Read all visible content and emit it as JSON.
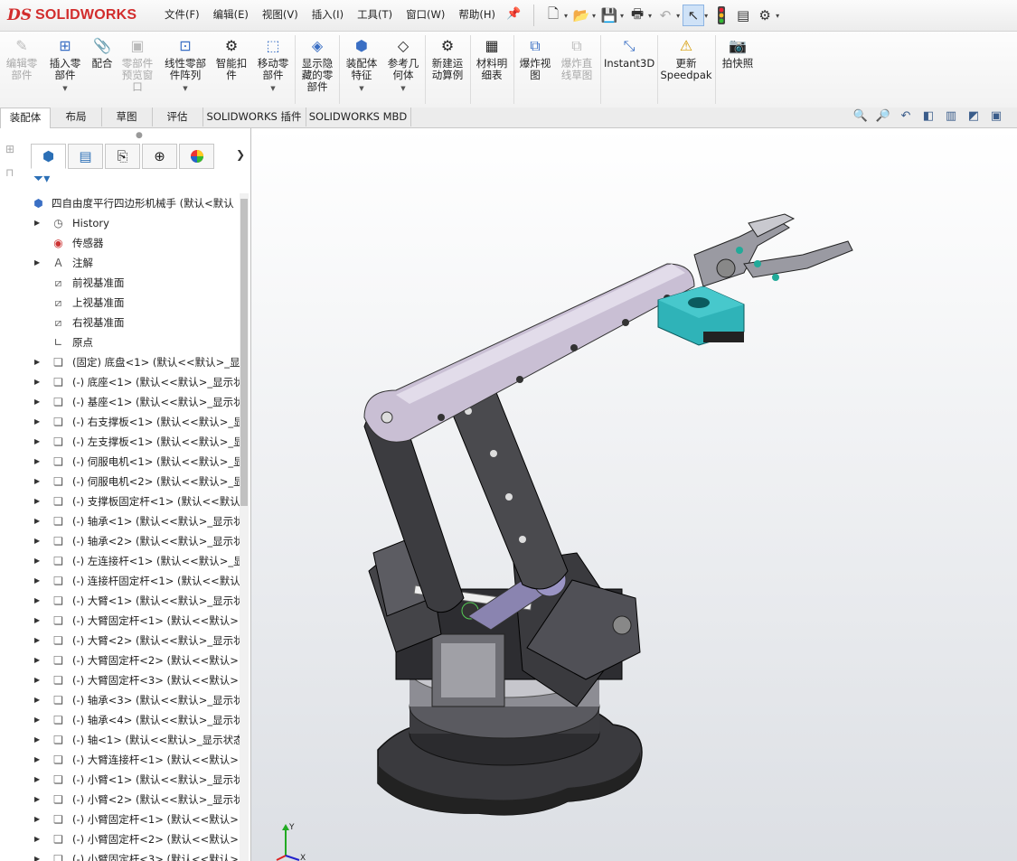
{
  "app": {
    "logo_ds": "DS",
    "logo_text": "SOLIDWORKS"
  },
  "menu": [
    "文件(F)",
    "编辑(E)",
    "视图(V)",
    "插入(I)",
    "工具(T)",
    "窗口(W)",
    "帮助(H)"
  ],
  "ribbon": {
    "edit_component": "编辑零\n部件",
    "insert_component": "插入零\n部件",
    "mate": "配合",
    "component_preview": "零部件\n预览窗\n口",
    "linear_pattern": "线性零部\n件阵列",
    "smart_fasteners": "智能扣\n件",
    "move_component": "移动零\n部件",
    "show_hidden": "显示隐\n藏的零\n部件",
    "assembly_features": "装配体\n特征",
    "reference_geometry": "参考几\n何体",
    "new_motion_study": "新建运\n动算例",
    "bom": "材料明\n细表",
    "exploded_view": "爆炸视\n图",
    "explode_line_sketch": "爆炸直\n线草图",
    "instant3d": "Instant3D",
    "update_speedpak": "更新\nSpeedpak",
    "snapshot": "拍快照"
  },
  "tabs": [
    "装配体",
    "布局",
    "草图",
    "评估",
    "SOLIDWORKS 插件",
    "SOLIDWORKS MBD"
  ],
  "tree": {
    "root": "四自由度平行四边形机械手  (默认<默认",
    "fixed_items": [
      {
        "label": "History",
        "icon": "history-icon"
      },
      {
        "label": "传感器",
        "icon": "sensor-icon"
      },
      {
        "label": "注解",
        "icon": "annotation-icon"
      },
      {
        "label": "前视基准面",
        "icon": "plane-icon"
      },
      {
        "label": "上视基准面",
        "icon": "plane-icon"
      },
      {
        "label": "右视基准面",
        "icon": "plane-icon"
      },
      {
        "label": "原点",
        "icon": "origin-icon"
      }
    ],
    "components": [
      "(固定) 底盘<1> (默认<<默认>_显",
      "(-) 底座<1> (默认<<默认>_显示状",
      "(-) 基座<1> (默认<<默认>_显示状",
      "(-) 右支撑板<1> (默认<<默认>_显",
      "(-) 左支撑板<1> (默认<<默认>_显",
      "(-) 伺服电机<1> (默认<<默认>_显",
      "(-) 伺服电机<2> (默认<<默认>_显",
      "(-) 支撑板固定杆<1> (默认<<默认",
      "(-) 轴承<1> (默认<<默认>_显示状",
      "(-) 轴承<2> (默认<<默认>_显示状",
      "(-) 左连接杆<1> (默认<<默认>_显",
      "(-) 连接杆固定杆<1> (默认<<默认",
      "(-) 大臂<1> (默认<<默认>_显示状",
      "(-) 大臂固定杆<1> (默认<<默认>",
      "(-) 大臂<2> (默认<<默认>_显示状",
      "(-) 大臂固定杆<2> (默认<<默认>",
      "(-) 大臂固定杆<3> (默认<<默认>",
      "(-) 轴承<3> (默认<<默认>_显示状",
      "(-) 轴承<4> (默认<<默认>_显示状",
      "(-) 轴<1> (默认<<默认>_显示状态",
      "(-) 大臂连接杆<1> (默认<<默认>",
      "(-) 小臂<1> (默认<<默认>_显示状",
      "(-) 小臂<2> (默认<<默认>_显示状",
      "(-) 小臂固定杆<1> (默认<<默认>",
      "(-) 小臂固定杆<2> (默认<<默认>",
      "(-) 小臂固定杆<3> (默认<<默认>"
    ]
  },
  "colors": {
    "brand": "#d22d2d",
    "arm": "#c9bfd4",
    "dark": "#4a4a4e",
    "teal": "#2fb3b8"
  },
  "triad": {
    "y": "Y",
    "x": "X"
  }
}
